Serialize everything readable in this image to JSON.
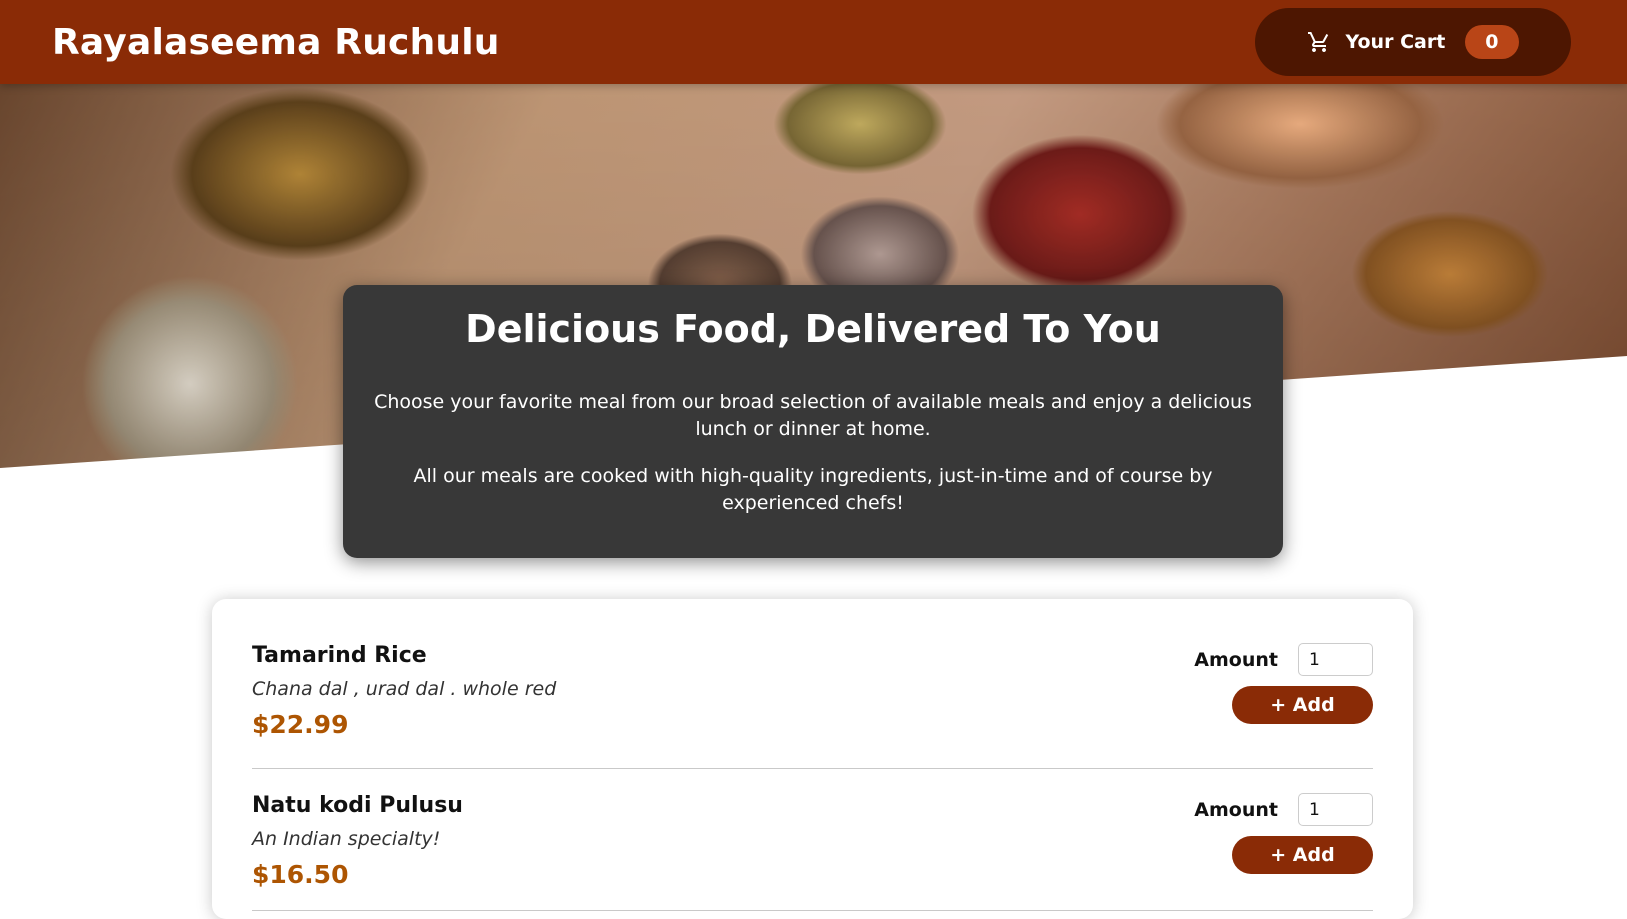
{
  "header": {
    "brand": "Rayalaseema Ruchulu",
    "cart_label": "Your Cart",
    "cart_count": "0",
    "cart_icon": "cart-icon"
  },
  "summary": {
    "title": "Delicious Food, Delivered To You",
    "paragraph1": "Choose your favorite meal from our broad selection of available meals and enjoy a delicious lunch or dinner at home.",
    "paragraph2": "All our meals are cooked with high-quality ingredients, just-in-time and of course by experienced chefs!"
  },
  "meals": [
    {
      "name": "Tamarind Rice",
      "description": "Chana dal , urad dal . whole red",
      "price": "$22.99",
      "amount_label": "Amount",
      "amount_value": "1",
      "add_label": "+ Add"
    },
    {
      "name": "Natu kodi Pulusu",
      "description": "An Indian specialty!",
      "price": "$16.50",
      "amount_label": "Amount",
      "amount_value": "1",
      "add_label": "+ Add"
    }
  ],
  "colors": {
    "brand": "#8a2b06",
    "cart_bg": "#4d1601",
    "badge_bg": "#b94517",
    "price": "#ad5502",
    "summary_bg": "#383838"
  }
}
